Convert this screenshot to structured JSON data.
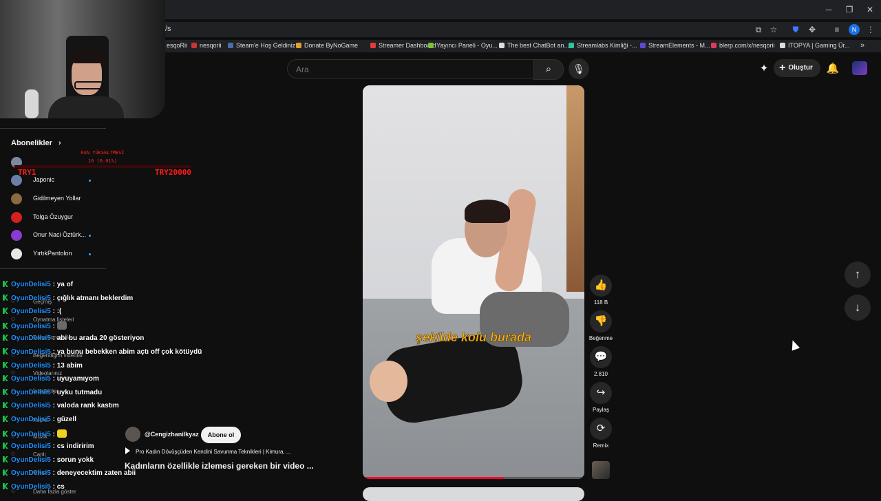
{
  "browser": {
    "url_fragment": "/s",
    "profile_initial": "N",
    "bookmarks": [
      {
        "label": "esqoRii",
        "color": "#cc3333"
      },
      {
        "label": "nesqorii",
        "color": "#cc3333"
      },
      {
        "label": "Steam'e Hoş Geldiniz",
        "color": "#4a6ea8"
      },
      {
        "label": "Donate ByNoGame",
        "color": "#e0a030"
      },
      {
        "label": "Streamer Dashboard",
        "color": "#e53a3a"
      },
      {
        "label": "Yayıncı Paneli - Oyu...",
        "color": "#7bbf3a"
      },
      {
        "label": "The best ChatBot an...",
        "color": "#dddddd"
      },
      {
        "label": "Streamlabs Kimliği -...",
        "color": "#2ec4a0"
      },
      {
        "label": "StreamElements - M...",
        "color": "#5a4bd1"
      },
      {
        "label": "blerp.com/x/nesqorii",
        "color": "#e03a5a"
      },
      {
        "label": "ITOPYA | Gaming Ür...",
        "color": "#dddddd"
      }
    ]
  },
  "header": {
    "search_placeholder": "Ara",
    "create_label": "Oluştur"
  },
  "sidebar": {
    "subscriptions_title": "Abonelikler",
    "subscriptions": [
      {
        "name": "Japonic",
        "color": "#6a7fa8",
        "new": true
      },
      {
        "name": "Gidilmeyen Yollar",
        "color": "#8a6a40",
        "new": false
      },
      {
        "name": "Tolga Özuygur",
        "color": "#d42020",
        "new": false
      },
      {
        "name": "Onur Naci Öztürk...",
        "color": "#8a3bd0",
        "new": true
      },
      {
        "name": "YırtıkPantolon",
        "color": "#e8e8e8",
        "new": true
      }
    ],
    "under_items": [
      "Geçmiş",
      "Oynatma listeleri",
      "Daha sonra izle",
      "Beğendiğim videolar",
      "Videolarınız",
      "İndirilenler",
      "Keşfet",
      "Müzik",
      "Canlı",
      "Oyun",
      "Daha fazla göster"
    ]
  },
  "overlay": {
    "rank_title": "RAN YÜKSELTMESİ",
    "rank_progress_text": "16 (0.01%)",
    "rank_progress_fraction": 0.0001,
    "rank_left": "TRY1",
    "rank_right": "TRY20000"
  },
  "chat": [
    {
      "user": "OyunDelisi5",
      "message": "ya of",
      "emote": null
    },
    {
      "user": "OyunDelisi5",
      "message": "çığlık atmanı beklerdim",
      "emote": null
    },
    {
      "user": "OyunDelisi5",
      "message": ":(",
      "emote": null
    },
    {
      "user": "OyunDelisi5",
      "message": "",
      "emote": "#6a6a6a"
    },
    {
      "user": "OyunDelisi5",
      "message": "abi bu arada 20 gösteriyon",
      "emote": null
    },
    {
      "user": "OyunDelisi5",
      "message": "ya bunu bebekken abim açtı off çok kötüydü",
      "emote": null
    },
    {
      "user": "OyunDelisi5",
      "message": "13 abim",
      "emote": null
    },
    {
      "user": "OyunDelisi5",
      "message": "uyuyamıyom",
      "emote": null
    },
    {
      "user": "OyunDelisi5",
      "message": "uyku tutmadu",
      "emote": null
    },
    {
      "user": "OyunDelisi5",
      "message": "valoda rank kastım",
      "emote": null
    },
    {
      "user": "OyunDelisi5",
      "message": "güzell",
      "emote": null
    },
    {
      "user": "OyunDelisi5",
      "message": "",
      "emote": "#f0d020"
    },
    {
      "user": "OyunDelisi5",
      "message": "cs indiririm",
      "emote": null
    },
    {
      "user": "OyunDelisi5",
      "message": "sorun yokk",
      "emote": null
    },
    {
      "user": "OyunDelisi5",
      "message": "deneyecektim zaten abii",
      "emote": null
    },
    {
      "user": "OyunDelisi5",
      "message": "cs",
      "emote": null
    }
  ],
  "short": {
    "caption": "şekilde kolu burada",
    "channel": "@Cengizhanilkyaz",
    "subscribe_label": "Abone ol",
    "related": "Pro Kadın Dövüşçüden Kendini Savunma Teknikleri | Kimura, ...",
    "title": "Kadınların özellikle izlemesi gereken bir video ...",
    "progress_fraction": 0.64
  },
  "actions": [
    {
      "name": "like",
      "icon": "👍",
      "label": "118 B"
    },
    {
      "name": "dislike",
      "icon": "👎",
      "label": "Beğenme"
    },
    {
      "name": "comments",
      "icon": "💬",
      "label": "2.810"
    },
    {
      "name": "share",
      "icon": "↪",
      "label": "Paylaş"
    },
    {
      "name": "remix",
      "icon": "⟳",
      "label": "Remix"
    }
  ],
  "colors": {
    "accent_red": "#ff0033",
    "chat_user": "#1e90ff",
    "caption": "#f5b01f",
    "overlay_red": "#ff2020"
  }
}
